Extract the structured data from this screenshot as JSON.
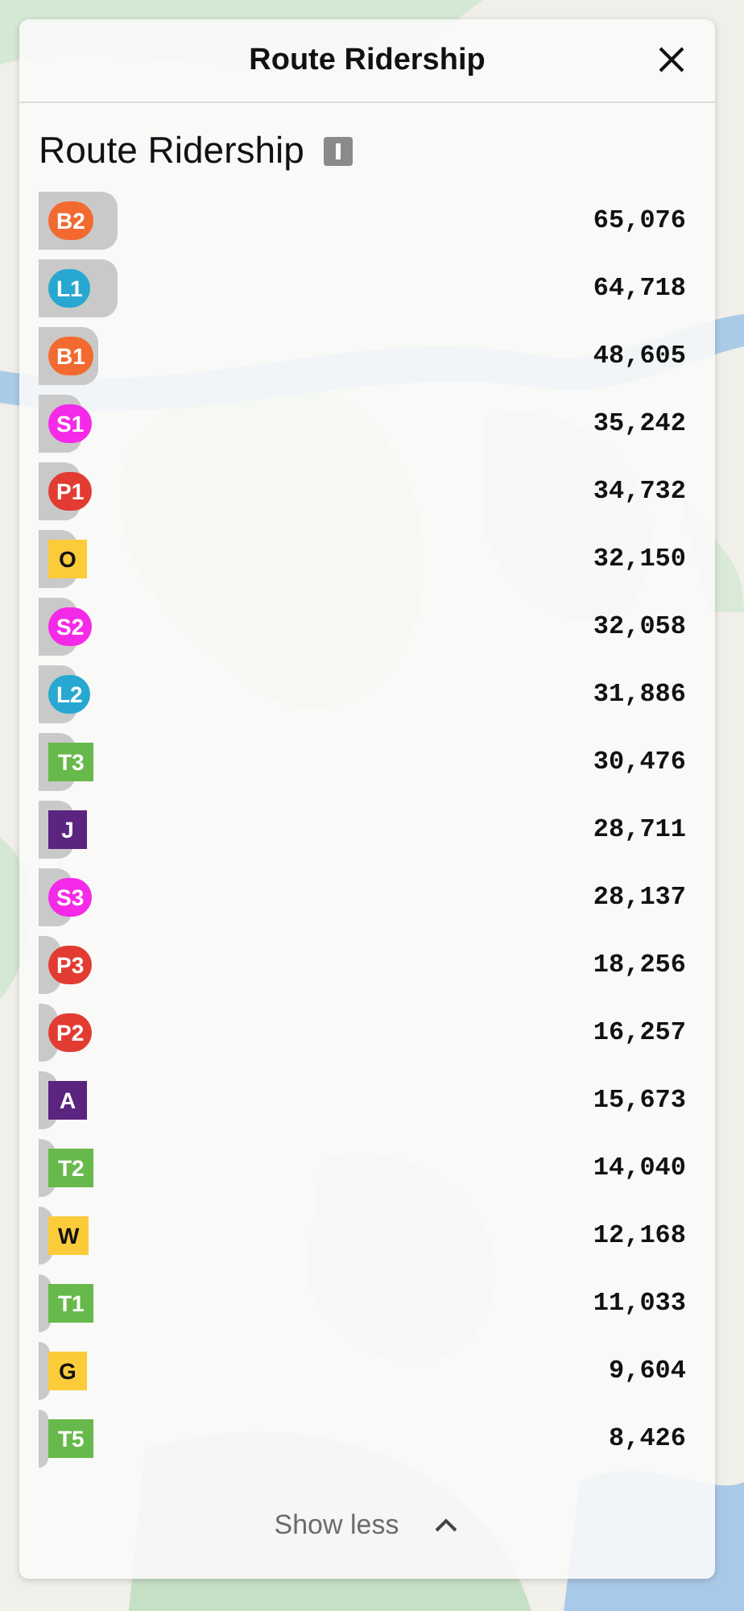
{
  "panel": {
    "title": "Route Ridership"
  },
  "section": {
    "title": "Route Ridership"
  },
  "routes": [
    {
      "label": "B2",
      "kind": "circle",
      "color": "#f26a30",
      "value": "65,076"
    },
    {
      "label": "L1",
      "kind": "circle",
      "color": "#28a8d0",
      "value": "64,718"
    },
    {
      "label": "B1",
      "kind": "circle",
      "color": "#f26a30",
      "value": "48,605"
    },
    {
      "label": "S1",
      "kind": "circle",
      "color": "#f52ae8",
      "value": "35,242"
    },
    {
      "label": "P1",
      "kind": "circle",
      "color": "#e23c32",
      "value": "34,732"
    },
    {
      "label": "O",
      "kind": "square",
      "color": "#fbcb3a",
      "value": "32,150"
    },
    {
      "label": "S2",
      "kind": "circle",
      "color": "#f52ae8",
      "value": "32,058"
    },
    {
      "label": "L2",
      "kind": "circle",
      "color": "#28a8d0",
      "value": "31,886"
    },
    {
      "label": "T3",
      "kind": "square",
      "color": "#67b94b",
      "value": "30,476"
    },
    {
      "label": "J",
      "kind": "square",
      "color": "#5a2480",
      "value": "28,711"
    },
    {
      "label": "S3",
      "kind": "circle",
      "color": "#f52ae8",
      "value": "28,137"
    },
    {
      "label": "P3",
      "kind": "circle",
      "color": "#e23c32",
      "value": "18,256"
    },
    {
      "label": "P2",
      "kind": "circle",
      "color": "#e23c32",
      "value": "16,257"
    },
    {
      "label": "A",
      "kind": "square",
      "color": "#5a2480",
      "value": "15,673"
    },
    {
      "label": "T2",
      "kind": "square",
      "color": "#67b94b",
      "value": "14,040"
    },
    {
      "label": "W",
      "kind": "square",
      "color": "#fbcb3a",
      "value": "12,168"
    },
    {
      "label": "T1",
      "kind": "square",
      "color": "#67b94b",
      "value": "11,033"
    },
    {
      "label": "G",
      "kind": "square",
      "color": "#fbcb3a",
      "value": "9,604"
    },
    {
      "label": "T5",
      "kind": "square",
      "color": "#67b94b",
      "value": "8,426"
    }
  ],
  "toggle": {
    "label": "Show less",
    "expanded": true
  }
}
